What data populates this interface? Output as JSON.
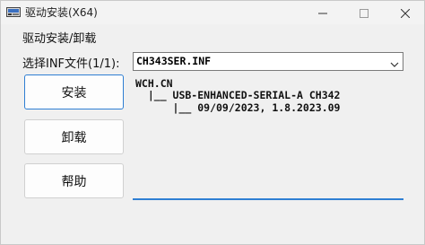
{
  "window": {
    "title": "驱动安装(X64)"
  },
  "titlebar": {
    "icons": [
      "app-icon",
      "minimize-icon",
      "maximize-icon",
      "close-icon"
    ]
  },
  "group": {
    "title": "驱动安装/卸载"
  },
  "inf": {
    "label": "选择INF文件(1/1):",
    "selected": "CH343SER.INF",
    "dropdown_icon": "chevron-down-icon"
  },
  "buttons": {
    "install": "安装",
    "uninstall": "卸载",
    "help": "帮助"
  },
  "info": {
    "lines": [
      "WCH.CN",
      "  |__ USB-ENHANCED-SERIAL-A CH342",
      "      |__ 09/09/2023, 1.8.2023.09"
    ]
  },
  "colors": {
    "accent": "#2f7fd3",
    "window_bg": "#f0f0f0"
  }
}
